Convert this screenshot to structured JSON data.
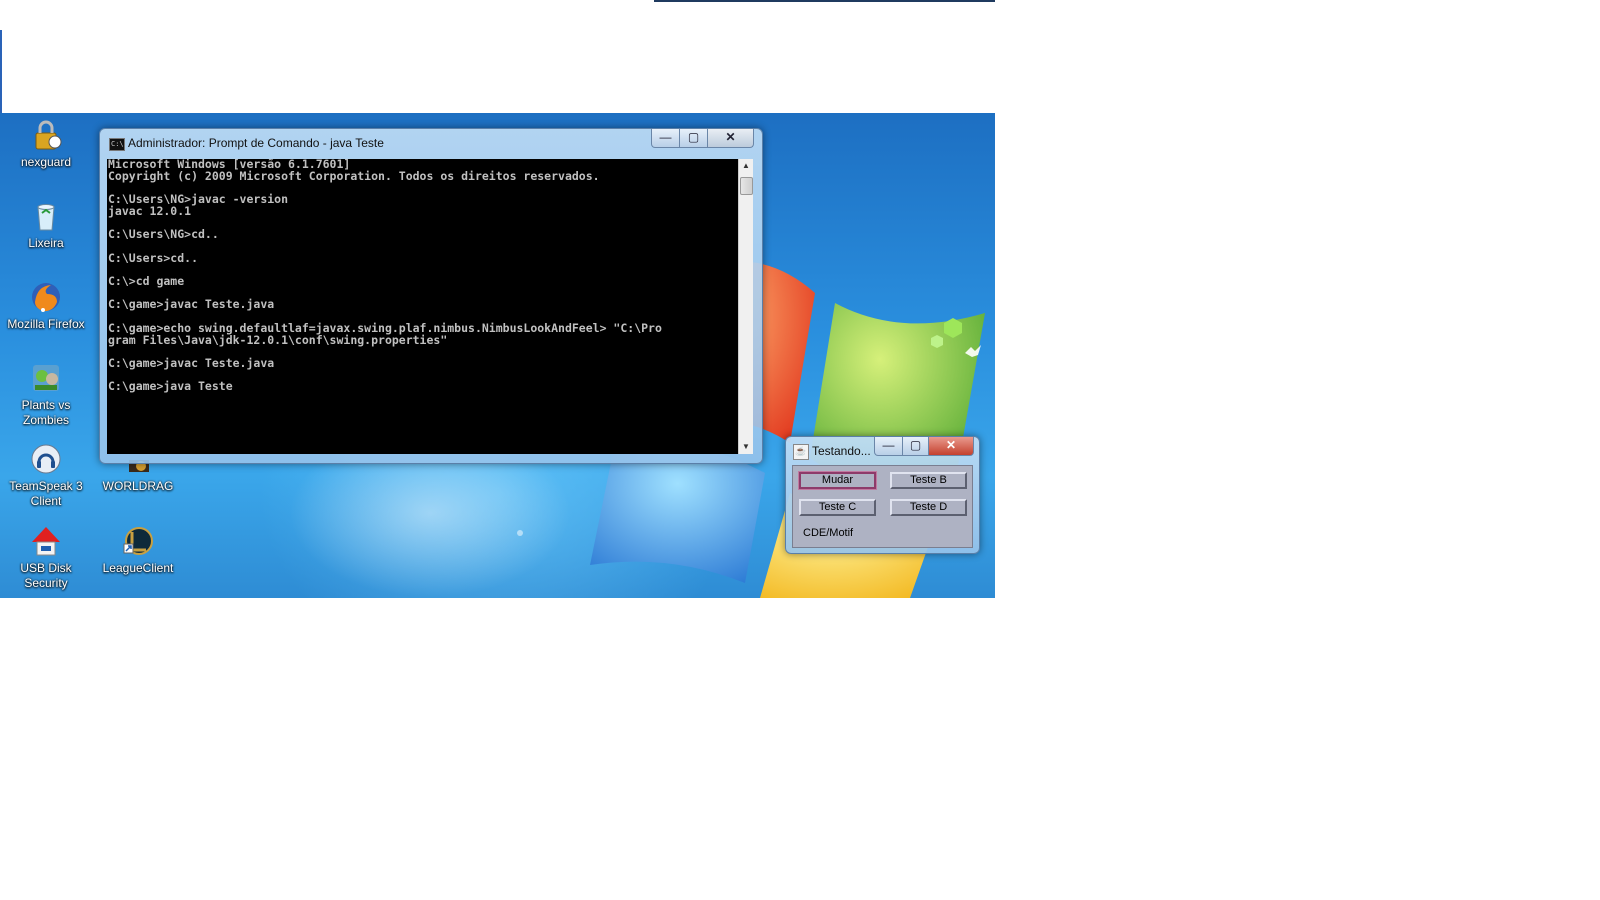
{
  "desktop_icons": [
    {
      "label": "nexguard",
      "icon": "padlock-icon"
    },
    {
      "label": "Lixeira",
      "icon": "recycle-bin-icon"
    },
    {
      "label": "Mozilla Firefox",
      "icon": "firefox-icon"
    },
    {
      "label": "Plants vs Zombies",
      "icon": "plants-vs-zombies-icon"
    },
    {
      "label": "TeamSpeak 3 Client",
      "icon": "teamspeak-icon"
    },
    {
      "label": "WORLDRAG",
      "icon": "worldrag-icon"
    },
    {
      "label": "USB Disk Security",
      "icon": "usb-disk-security-icon"
    },
    {
      "label": "LeagueClient",
      "icon": "league-client-icon"
    }
  ],
  "cmd_window": {
    "title": "Administrador: Prompt de Comando - java  Teste",
    "icon_text": "C:\\",
    "controls": {
      "minimize": "—",
      "maximize": "▢",
      "close": "✕"
    },
    "console_lines": [
      "Microsoft Windows [versão 6.1.7601]",
      "Copyright (c) 2009 Microsoft Corporation. Todos os direitos reservados.",
      "",
      "C:\\Users\\NG>javac -version",
      "javac 12.0.1",
      "",
      "C:\\Users\\NG>cd..",
      "",
      "C:\\Users>cd..",
      "",
      "C:\\>cd game",
      "",
      "C:\\game>javac Teste.java",
      "",
      "C:\\game>echo swing.defaultlaf=javax.swing.plaf.nimbus.NimbusLookAndFeel> \"C:\\Pro",
      "gram Files\\Java\\jdk-12.0.1\\conf\\swing.properties\"",
      "",
      "C:\\game>javac Teste.java",
      "",
      "C:\\game>java Teste"
    ],
    "scroll_up": "▲",
    "scroll_down": "▼"
  },
  "java_window": {
    "title": "Testando...",
    "icon_text": "☕",
    "controls": {
      "minimize": "—",
      "maximize": "▢",
      "close": "✕"
    },
    "buttons": [
      "Mudar",
      "Teste B",
      "Teste C",
      "Teste D"
    ],
    "look_and_feel_label": "CDE/Motif"
  },
  "colors": {
    "console_bg": "#000000",
    "console_text": "#c0c0c0",
    "motif_panel": "#aeb2c3"
  }
}
